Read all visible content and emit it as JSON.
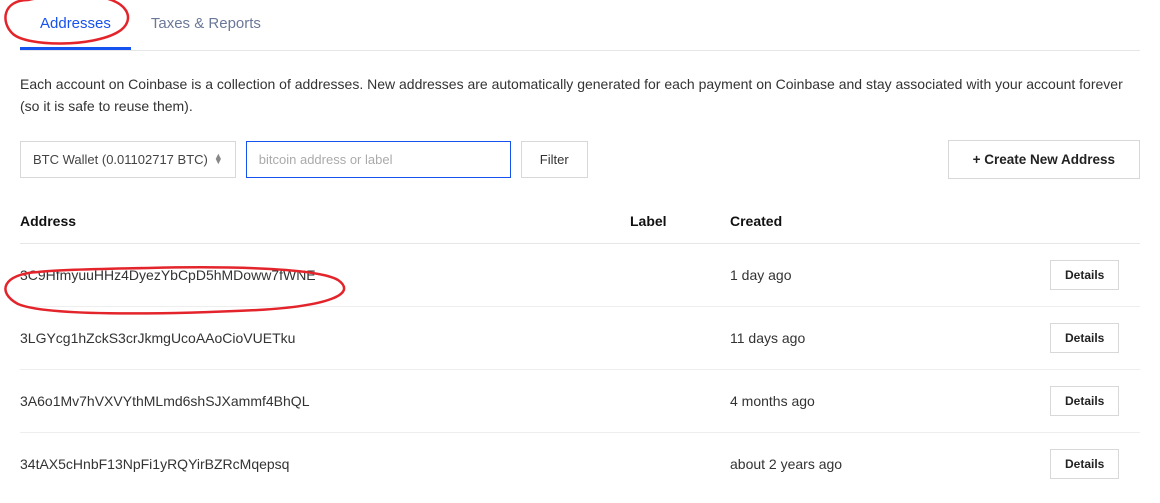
{
  "tabs": {
    "addresses": "Addresses",
    "taxes": "Taxes & Reports"
  },
  "description": "Each account on Coinbase is a collection of addresses. New addresses are automatically generated for each payment on Coinbase and stay associated with your account forever (so it is safe to reuse them).",
  "controls": {
    "wallet_label": "BTC Wallet (0.01102717 BTC)",
    "search_placeholder": "bitcoin address or label",
    "filter_label": "Filter",
    "create_label": "+ Create New Address"
  },
  "headers": {
    "address": "Address",
    "label": "Label",
    "created": "Created"
  },
  "rows": [
    {
      "address": "3C9HfmyuuHHz4DyezYbCpD5hMDoww7fWNE",
      "label": "",
      "created": "1 day ago",
      "details": "Details"
    },
    {
      "address": "3LGYcg1hZckS3crJkmgUcoAAoCioVUETku",
      "label": "",
      "created": "11 days ago",
      "details": "Details"
    },
    {
      "address": "3A6o1Mv7hVXVYthMLmd6shSJXammf4BhQL",
      "label": "",
      "created": "4 months ago",
      "details": "Details"
    },
    {
      "address": "34tAX5cHnbF13NpFi1yRQYirBZRcMqepsq",
      "label": "",
      "created": "about 2 years ago",
      "details": "Details"
    }
  ]
}
